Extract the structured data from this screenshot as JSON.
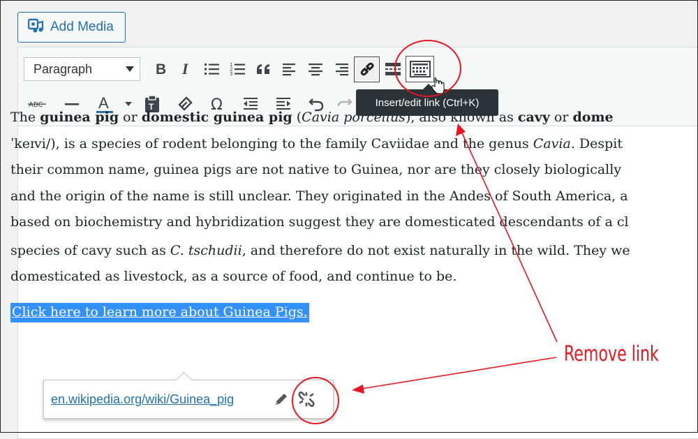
{
  "add_media": {
    "label": "Add Media"
  },
  "toolbar": {
    "format_select": "Paragraph",
    "tooltip": "Insert/edit link (Ctrl+K)",
    "strike_label": "ABC",
    "text_color_label": "A",
    "accent": "#2271b1"
  },
  "content": {
    "p1": {
      "t1": "The ",
      "b1": "guinea pig",
      "t2": " or ",
      "b2": "domestic guinea pig",
      "t3": " (",
      "i1": "Cavia porcellus",
      "t4": "), also known as ",
      "b3": "cavy",
      "t5": " or ",
      "b4": "dome"
    },
    "p2": {
      "t1": "ˈkeɪvi/), is a species of rodent belonging to the family Caviidae and the genus ",
      "i1": "Cavia",
      "t2": ". Despit"
    },
    "p3": "their common name, guinea pigs are not native to Guinea, nor are they closely biologically",
    "p4": "and the origin of the name is still unclear. They originated in the Andes of South America, a",
    "p5": "based on biochemistry and hybridization suggest they are domesticated descendants of a cl",
    "p6": {
      "t1": "species of cavy such as ",
      "i1": "C. tschudii",
      "t2": ", and therefore do not exist naturally in the wild. They we"
    },
    "p7": "domesticated as livestock, as a source of food, and continue to be.",
    "link_text": "Click here to learn more about Guinea Pigs."
  },
  "link_popup": {
    "url": "en.wikipedia.org/wiki/Guinea_pig"
  },
  "annotation": {
    "label": "Remove link",
    "color": "#e8171f"
  }
}
